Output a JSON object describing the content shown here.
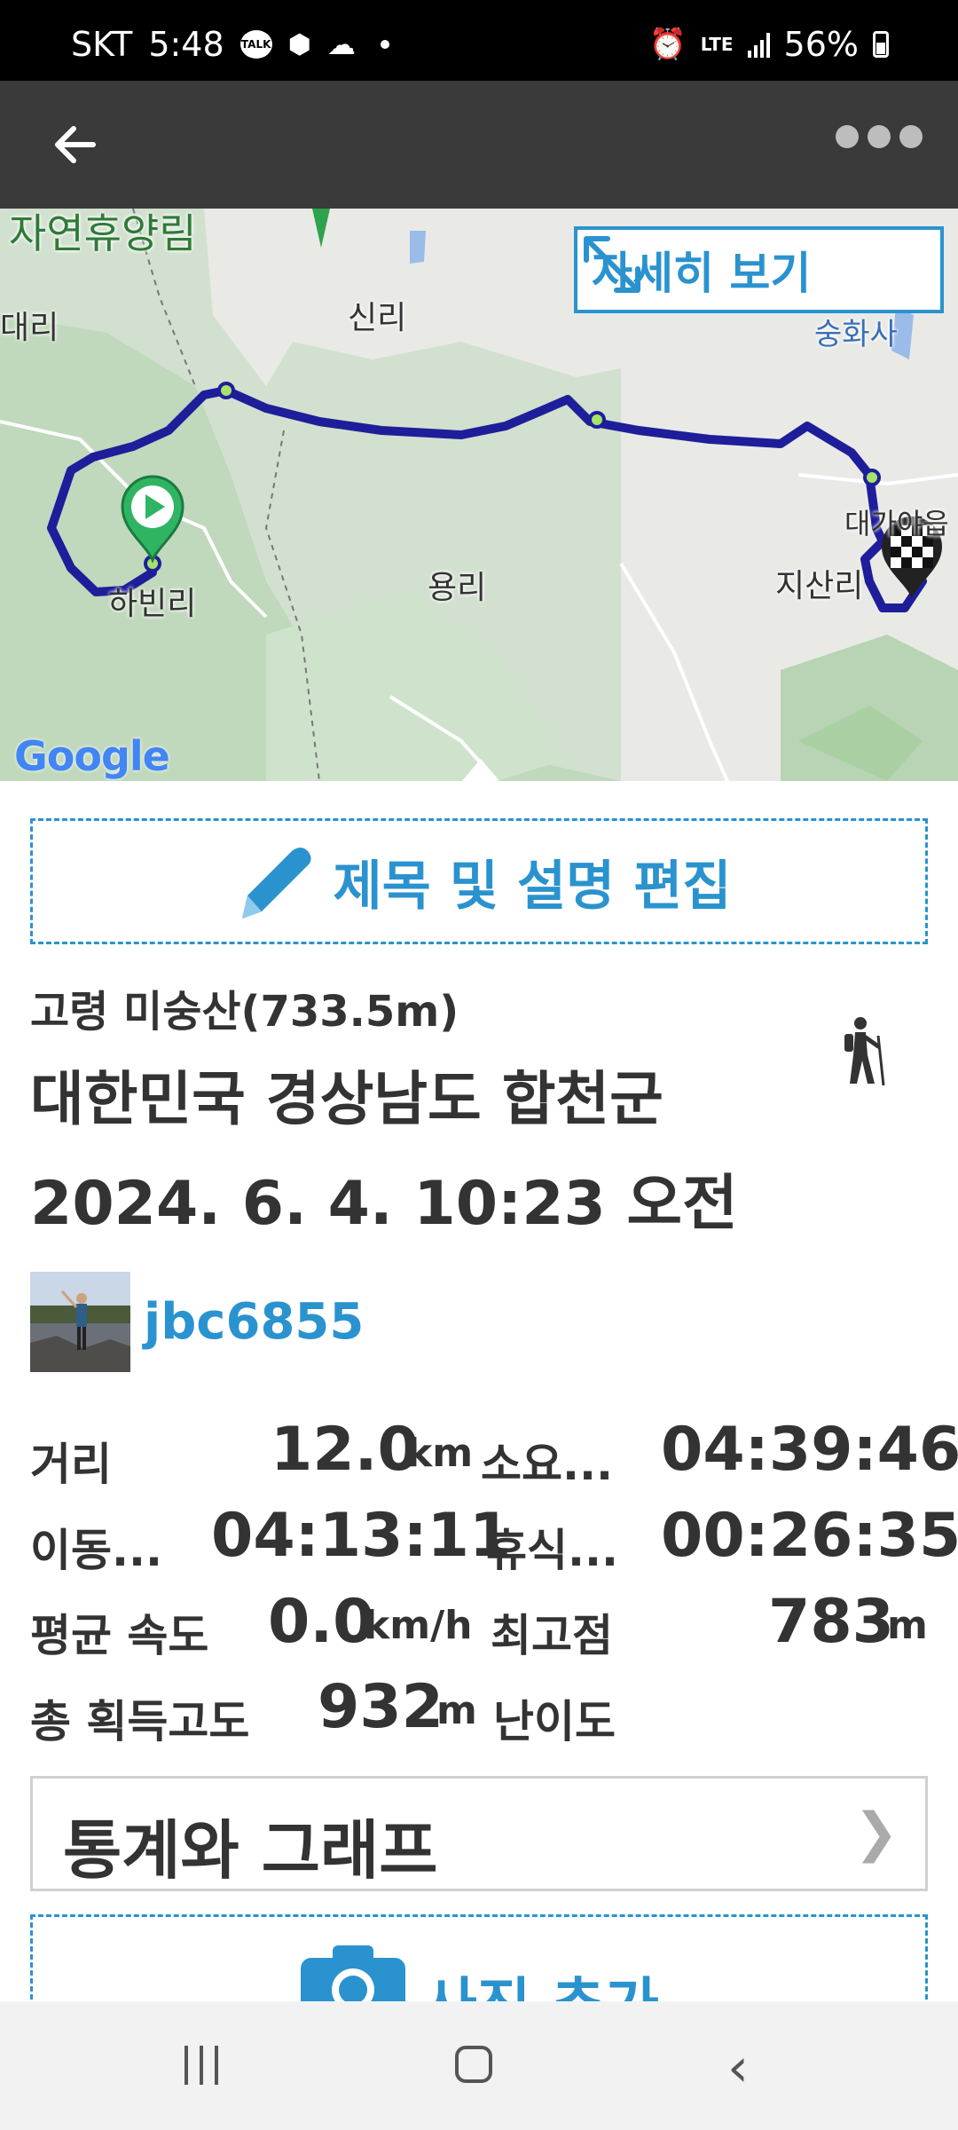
{
  "status_bar": {
    "carrier": "SKT",
    "time": "5:48",
    "notif_talk": "TALK",
    "network": "LTE",
    "battery": "56%"
  },
  "map": {
    "detail_label": "자세히 보기",
    "labels": {
      "forest": "자연휴양림",
      "sinri": "신리",
      "daeri": "대리",
      "hwabinri": "하빈리",
      "yongri": "용리",
      "jisanri": "지산리",
      "sunghwasa": "숭화사",
      "daegaya": "대가야읍"
    },
    "attribution": "Google"
  },
  "edit_title_label": "제목 및 설명 편집",
  "track": {
    "subtitle": "고령 미숭산(733.5m)",
    "location": "대한민국 경상남도 합천군",
    "datetime": "2024. 6. 4. 10:23 오전",
    "username": "jbc6855",
    "activity_icon": "hiking-icon"
  },
  "stats": {
    "distance_label": "거리",
    "distance_value": "12.0",
    "distance_unit": "km",
    "total_time_label": "소요...",
    "total_time_value": "04:39:46",
    "moving_label": "이동...",
    "moving_value": "04:13:11",
    "rest_label": "휴식...",
    "rest_value": "00:26:35",
    "avg_speed_label": "평균 속도",
    "avg_speed_value": "0.0",
    "avg_speed_unit": "km/h",
    "max_alt_label": "최고점",
    "max_alt_value": "783",
    "max_alt_unit": "m",
    "ascent_label": "총 획득고도",
    "ascent_value": "932",
    "ascent_unit": "m",
    "difficulty_label": "난이도"
  },
  "stats_graph_label": "통계와 그래프",
  "add_photo_label": "사진 추가",
  "colors": {
    "accent": "#2a93cf",
    "appbar": "#3a3a3a",
    "track_line": "#1e1e9a",
    "start_marker": "#2fb562"
  }
}
